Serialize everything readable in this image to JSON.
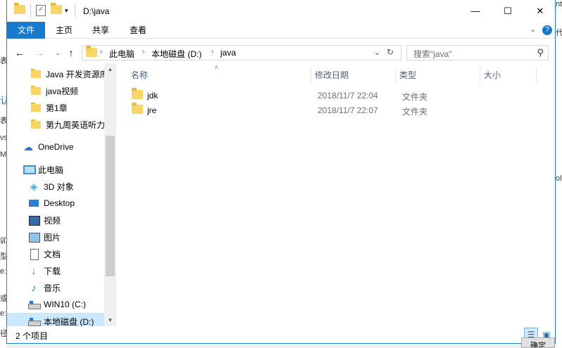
{
  "window": {
    "title": "D:\\java",
    "controls": {
      "minimize": "—",
      "maximize": "☐",
      "close": "✕"
    }
  },
  "ribbon": {
    "tabs": [
      {
        "label": "文件",
        "active": true
      },
      {
        "label": "主页"
      },
      {
        "label": "共享"
      },
      {
        "label": "查看"
      }
    ],
    "expand_icon": "chevron-down-icon",
    "help_icon": "?"
  },
  "address": {
    "crumbs": [
      "此电脑",
      "本地磁盘 (D:)",
      "java"
    ],
    "refresh_icon": "↻",
    "dropdown_icon": "⌄"
  },
  "search": {
    "placeholder": "搜索\"java\""
  },
  "nav_pane": {
    "quick_items": [
      {
        "label": "Java 开发资源库",
        "icon": "folder-icon"
      },
      {
        "label": "java视频",
        "icon": "folder-icon"
      },
      {
        "label": "第1章",
        "icon": "folder-icon"
      },
      {
        "label": "第九周英语听力",
        "icon": "folder-icon"
      }
    ],
    "onedrive": "OneDrive",
    "this_pc": "此电脑",
    "pc_items": [
      {
        "label": "3D 对象",
        "icon": "cube-icon"
      },
      {
        "label": "Desktop",
        "icon": "desktop-icon"
      },
      {
        "label": "视频",
        "icon": "video-icon"
      },
      {
        "label": "图片",
        "icon": "picture-icon"
      },
      {
        "label": "文档",
        "icon": "document-icon"
      },
      {
        "label": "下载",
        "icon": "download-icon"
      },
      {
        "label": "音乐",
        "icon": "music-icon"
      },
      {
        "label": "WIN10 (C:)",
        "icon": "drive-icon"
      },
      {
        "label": "本地磁盘 (D:)",
        "icon": "drive-icon",
        "selected": true
      }
    ]
  },
  "columns": {
    "name": "名称",
    "date": "修改日期",
    "type": "类型",
    "size": "大小"
  },
  "files": [
    {
      "name": "jdk",
      "date": "2018/11/7 22:04",
      "type": "文件夹"
    },
    {
      "name": "jre",
      "date": "2018/11/7 22:07",
      "type": "文件夹"
    }
  ],
  "status": {
    "count": "2 个项目"
  },
  "background": {
    "left_fragments": [
      "表",
      "认",
      "表",
      "vs",
      "M",
      "卯",
      "型:",
      "e:",
      "或",
      "e:",
      "径"
    ],
    "right_fragments": [
      "nt",
      "代",
      "ol"
    ],
    "ok_button": "确定"
  }
}
